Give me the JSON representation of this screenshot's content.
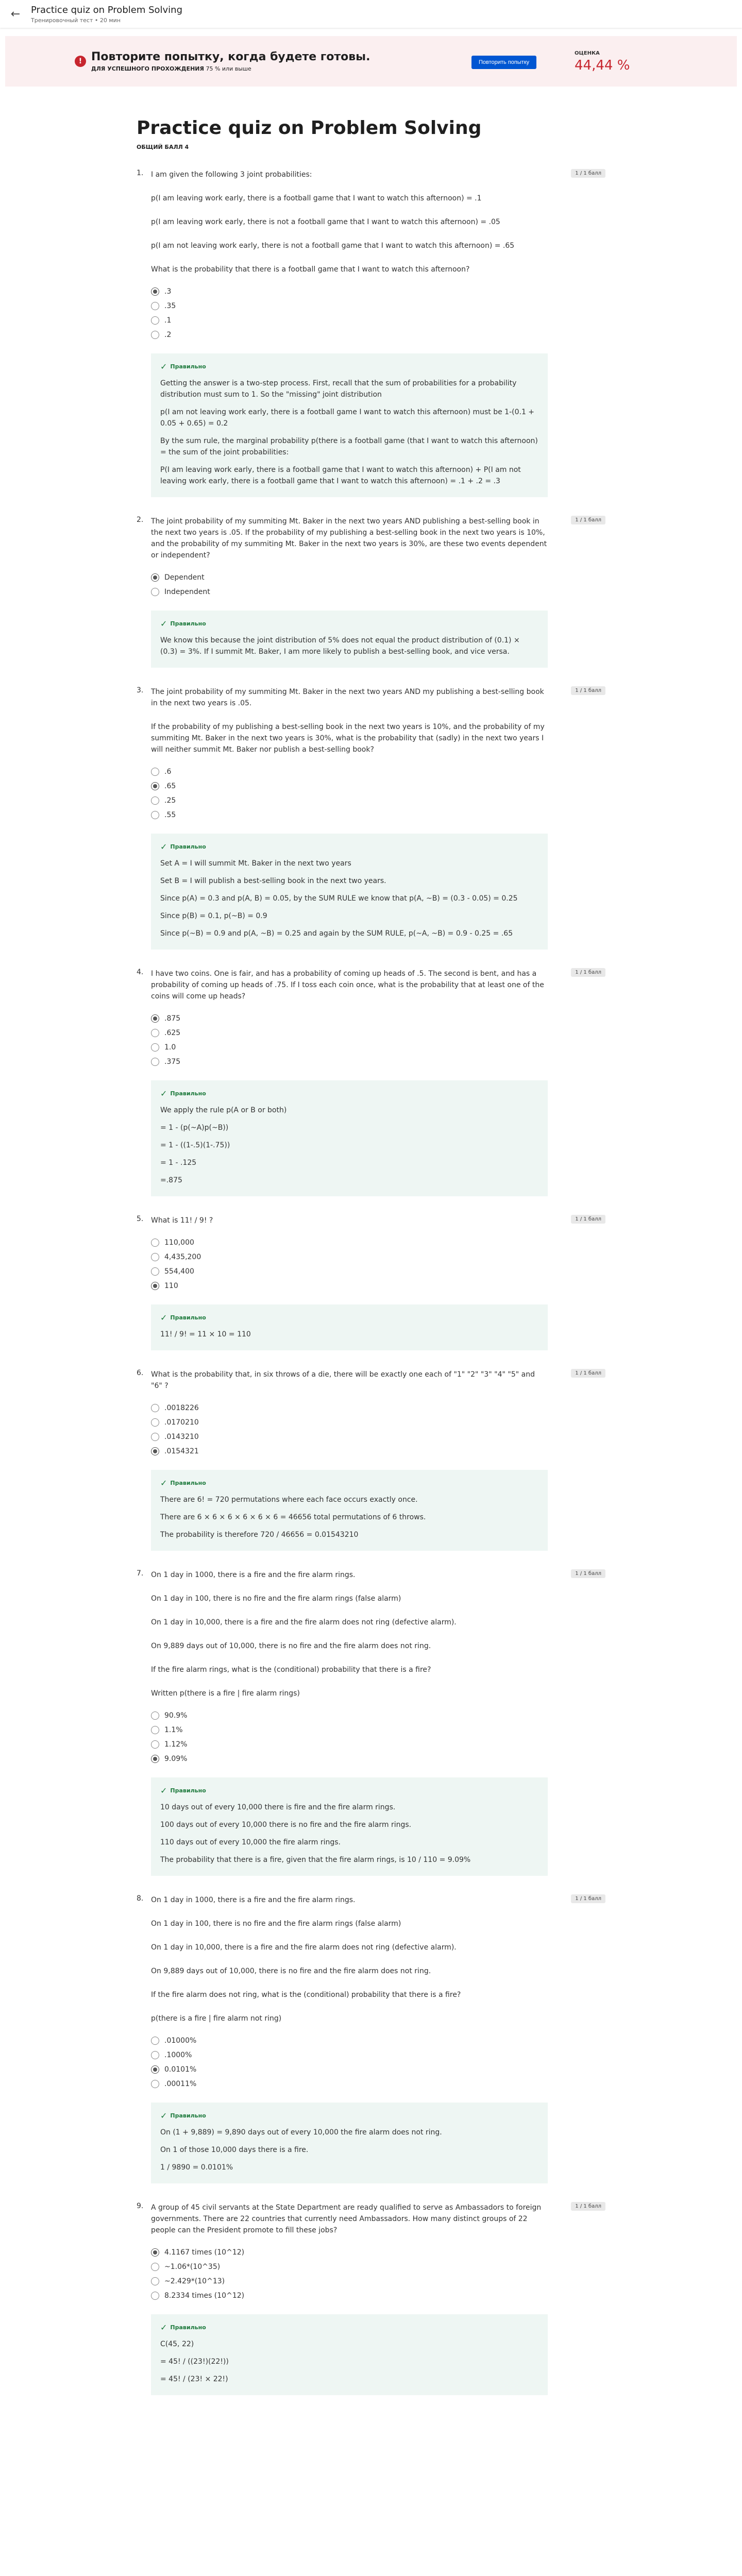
{
  "topbar": {
    "title": "Practice quiz on Problem Solving",
    "subtitle": "Тренировочный тест • 20 мин"
  },
  "banner": {
    "title": "Повторите попытку, когда будете готовы.",
    "sub_bold": "ДЛЯ УСПЕШНОГО ПРОХОЖДЕНИЯ",
    "sub_rest": "75 % или выше",
    "retry": "Повторить попытку",
    "grade_label": "ОЦЕНКА",
    "grade_value": "44,44 %"
  },
  "page": {
    "title": "Practice quiz on Problem Solving",
    "total": "ОБЩИЙ БАЛЛ 4"
  },
  "questions": [
    {
      "num": "1.",
      "badge": "1 / 1 балл",
      "paras": [
        "I am given the following 3 joint probabilities:",
        "p(I am leaving work early, there is a football game that I want to watch this afternoon) = .1",
        "p(I am leaving work early, there is not a football game that I want to watch this afternoon) = .05",
        "p(I am not leaving work early, there is not a football game that I want to watch this afternoon) = .65",
        "What is the probability that there is a football game that I want to watch this afternoon?"
      ],
      "options": [
        ".3",
        ".35",
        ".1",
        ".2"
      ],
      "selected": 0,
      "fb_label": "Правильно",
      "fb": [
        "Getting the answer is a two-step process. First, recall that the sum of probabilities for a probability distribution must sum to 1. So the \"missing\" joint distribution",
        "p(I am not leaving work early, there is a football game I want to watch this afternoon) must be 1-(0.1 + 0.05 + 0.65) = 0.2",
        "By the sum rule, the marginal probability p(there is a football game (that I want to watch this afternoon) = the sum of the joint probabilities:",
        "P(I am leaving work early, there is a football game that I want to watch this afternoon) + P(I am not leaving work early, there is a football game that I want to watch this afternoon) = .1 + .2 = .3"
      ]
    },
    {
      "num": "2.",
      "badge": "1 / 1 балл",
      "paras": [
        "The joint probability of my summiting Mt. Baker in the next two years AND publishing a best-selling book in the next two years is .05. If the probability of my publishing a best-selling book in the next two years is 10%, and the probability of my summiting Mt. Baker in the next two years is 30%, are these two events dependent or independent?"
      ],
      "options": [
        "Dependent",
        "Independent"
      ],
      "selected": 0,
      "fb_label": "Правильно",
      "fb": [
        "We know this because the joint distribution of 5% does not equal the product distribution of (0.1) × (0.3) = 3%. If I summit Mt. Baker, I am more likely to publish a best-selling book, and vice versa."
      ]
    },
    {
      "num": "3.",
      "badge": "1 / 1 балл",
      "paras": [
        "The joint probability of my summiting Mt. Baker in the next two years AND my publishing a best-selling book in the next two years is .05.",
        "If the probability of my publishing a best-selling book in the next two years is 10%, and the probability of my summiting Mt. Baker in the next two years is 30%, what is the probability that (sadly) in the next two years I will neither summit Mt. Baker nor publish a best-selling book?"
      ],
      "options": [
        ".6",
        ".65",
        ".25",
        ".55"
      ],
      "selected": 1,
      "fb_label": "Правильно",
      "fb": [
        "Set A = I will summit Mt. Baker in the next two years",
        "Set B = I will publish a best-selling book in the next two years.",
        "Since p(A) = 0.3 and p(A, B) = 0.05, by the SUM RULE we know that p(A, ~B) = (0.3 - 0.05) = 0.25",
        "Since p(B) = 0.1, p(~B) = 0.9",
        "Since p(~B) = 0.9 and p(A, ~B) = 0.25 and again by the SUM RULE, p(~A, ~B) = 0.9 - 0.25 = .65"
      ]
    },
    {
      "num": "4.",
      "badge": "1 / 1 балл",
      "paras": [
        "I have two coins. One is fair, and has a probability of coming up heads of .5. The second is bent, and has a probability of coming up heads of .75. If I toss each coin once, what is the probability that at least one of the coins will come up heads?"
      ],
      "options": [
        ".875",
        ".625",
        "1.0",
        ".375"
      ],
      "selected": 0,
      "fb_label": "Правильно",
      "fb": [
        "We apply the rule p(A or B or both)",
        "= 1 - (p(~A)p(~B))",
        "= 1 - ((1-.5)(1-.75))",
        "= 1 - .125",
        "=.875"
      ]
    },
    {
      "num": "5.",
      "badge": "1 / 1 балл",
      "paras": [
        "What is 11! / 9! ?"
      ],
      "options": [
        "110,000",
        "4,435,200",
        "554,400",
        "110"
      ],
      "selected": 3,
      "fb_label": "Правильно",
      "fb": [
        "11! / 9! = 11 × 10 = 110"
      ]
    },
    {
      "num": "6.",
      "badge": "1 / 1 балл",
      "paras": [
        "What is the probability that, in six throws of a die, there will be exactly one each of \"1\" \"2\" \"3\" \"4\" \"5\" and \"6\" ?"
      ],
      "options": [
        ".0018226",
        ".0170210",
        ".0143210",
        ".0154321"
      ],
      "selected": 3,
      "fb_label": "Правильно",
      "fb": [
        "There are 6! = 720 permutations where each face occurs exactly once.",
        "There are 6 × 6 × 6 × 6 × 6 × 6 = 46656 total permutations of 6 throws.",
        "The probability is therefore 720 / 46656 = 0.01543210"
      ]
    },
    {
      "num": "7.",
      "badge": "1 / 1 балл",
      "paras": [
        "On 1 day in 1000, there is a fire and the fire alarm rings.",
        "On 1 day in 100, there is no fire and the fire alarm rings (false alarm)",
        "On 1 day in 10,000, there is a fire and the fire alarm does not ring (defective alarm).",
        "On 9,889 days out of 10,000, there is no fire and the fire alarm does not ring.",
        "If the fire alarm rings, what is the (conditional) probability that there is a fire?",
        "Written p(there is a fire | fire alarm rings)"
      ],
      "options": [
        "90.9%",
        "1.1%",
        "1.12%",
        "9.09%"
      ],
      "selected": 3,
      "fb_label": "Правильно",
      "fb": [
        "10 days out of every 10,000 there is fire and the fire alarm rings.",
        "100 days out of every 10,000 there is no fire and the fire alarm rings.",
        "110 days out of every 10,000 the fire alarm rings.",
        "The probability that there is a fire, given that the fire alarm rings, is 10 / 110 = 9.09%"
      ]
    },
    {
      "num": "8.",
      "badge": "1 / 1 балл",
      "paras": [
        "On 1 day in 1000, there is a fire and the fire alarm rings.",
        "On 1 day in 100, there is no fire and the fire alarm rings (false alarm)",
        "On 1 day in 10,000, there is a fire and the fire alarm does not ring (defective alarm).",
        "On 9,889 days out of 10,000, there is no fire and the fire alarm does not ring.",
        "If the fire alarm does not ring, what is the (conditional) probability that there is a fire?",
        "p(there is a fire | fire alarm not ring)"
      ],
      "options": [
        ".01000%",
        ".1000%",
        "0.0101%",
        ".00011%"
      ],
      "selected": 2,
      "fb_label": "Правильно",
      "fb": [
        "On (1 + 9,889) = 9,890 days out of every 10,000 the fire alarm does not ring.",
        "On 1 of those 10,000 days there is a fire.",
        "1 / 9890 = 0.0101%"
      ]
    },
    {
      "num": "9.",
      "badge": "1 / 1 балл",
      "paras": [
        "A group of 45 civil servants at the State Department are ready qualified to serve as Ambassadors to foreign governments. There are 22 countries that currently need Ambassadors. How many distinct groups of 22 people can the President promote to fill these jobs?"
      ],
      "options": [
        "4.1167 times (10^12)",
        "~1.06*(10^35)",
        "~2.429*(10^13)",
        "8.2334 times (10^12)"
      ],
      "selected": 0,
      "fb_label": "Правильно",
      "fb": [
        "C(45, 22)",
        "= 45! / ((23!)(22!))",
        "= 45! / (23! × 22!)"
      ]
    }
  ]
}
